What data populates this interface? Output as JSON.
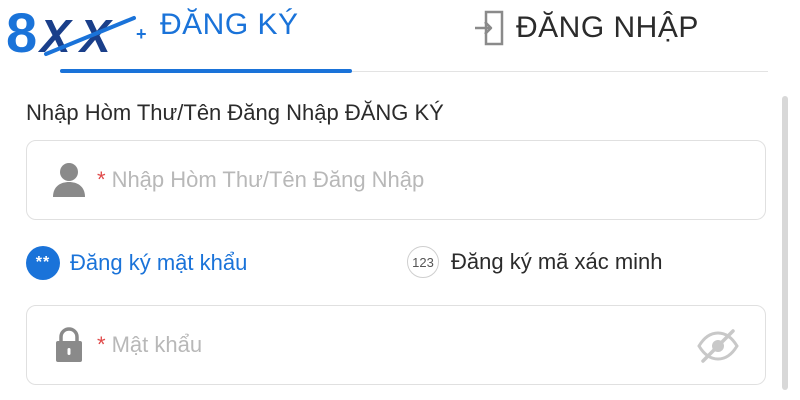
{
  "logo": {
    "text": "8XX",
    "plus": "+"
  },
  "tabs": {
    "register_label": "ĐĂNG KÝ",
    "login_label": "ĐĂNG NHẬP",
    "active": "register"
  },
  "form": {
    "username_label": "Nhập Hòm Thư/Tên Đăng Nhập ĐĂNG KÝ",
    "username_required": "*",
    "username_placeholder": "Nhập Hòm Thư/Tên Đăng Nhập",
    "methods": {
      "password_badge": "**",
      "password_label": "Đăng ký mật khẩu",
      "code_badge": "123",
      "code_label": "Đăng ký mã xác minh"
    },
    "password_required": "*",
    "password_placeholder": "Mật khẩu"
  },
  "icons": {
    "login": "login-door-icon",
    "user": "user-icon",
    "lock": "lock-icon",
    "eye": "eye-off-icon"
  },
  "colors": {
    "accent": "#1a73d9",
    "required": "#e04a4a",
    "icon_gray": "#8a8a8a"
  }
}
